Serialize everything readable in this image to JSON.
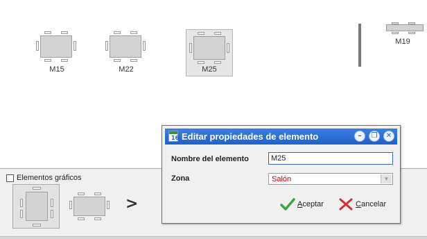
{
  "tables": [
    {
      "label": "M15",
      "selected": false
    },
    {
      "label": "M22",
      "selected": false
    },
    {
      "label": "M25",
      "selected": true
    },
    {
      "label": "M19",
      "selected": false
    }
  ],
  "palette": {
    "checkbox_label": "Elementos gráficos",
    "checked": false,
    "arrow_glyph": ">"
  },
  "dialog": {
    "title": "Editar propiedades de elemento",
    "title_icon": "calendar-icon",
    "name_label": "Nombre del elemento",
    "name_value": "M25",
    "zone_label": "Zona",
    "zone_value": "Salón",
    "accept_label": "Aceptar",
    "cancel_label": "Cancelar",
    "window_buttons": [
      "minimize",
      "restore",
      "close"
    ]
  },
  "colors": {
    "titlebar": "#1f62c8",
    "zone_text": "#c00000",
    "accept_icon": "#3aa53a",
    "cancel_icon": "#d03030"
  }
}
